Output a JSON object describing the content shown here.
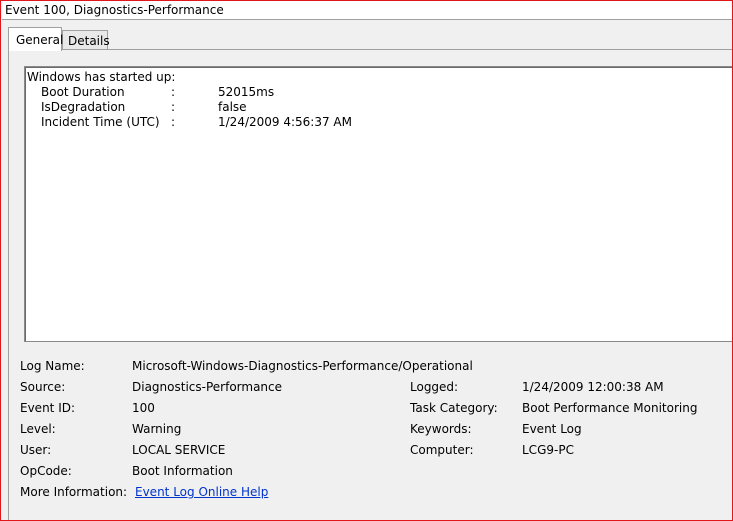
{
  "window": {
    "title": "Event 100, Diagnostics-Performance"
  },
  "tabs": [
    {
      "label": "General",
      "active": true
    },
    {
      "label": "Details",
      "active": false
    }
  ],
  "message": {
    "intro": "Windows has started up:",
    "rows": [
      {
        "name": "Boot Duration",
        "sep": ":",
        "value": "52015ms"
      },
      {
        "name": "IsDegradation",
        "sep": ":",
        "value": "false"
      },
      {
        "name": "Incident Time (UTC)",
        "sep": ":",
        "value": "1/24/2009 4:56:37 AM"
      }
    ]
  },
  "details": {
    "log_name": {
      "label": "Log Name:",
      "value": "Microsoft-Windows-Diagnostics-Performance/Operational"
    },
    "source": {
      "label": "Source:",
      "value": "Diagnostics-Performance"
    },
    "logged": {
      "label": "Logged:",
      "value": "1/24/2009 12:00:38 AM"
    },
    "event_id": {
      "label": "Event ID:",
      "value": "100"
    },
    "task_category": {
      "label": "Task Category:",
      "value": "Boot Performance Monitoring"
    },
    "level": {
      "label": "Level:",
      "value": "Warning"
    },
    "keywords": {
      "label": "Keywords:",
      "value": "Event Log"
    },
    "user": {
      "label": "User:",
      "value": "LOCAL SERVICE"
    },
    "computer": {
      "label": "Computer:",
      "value": "LCG9-PC"
    },
    "opcode": {
      "label": "OpCode:",
      "value": "Boot Information"
    },
    "more_info": {
      "label": "More Information:",
      "link": "Event Log Online Help"
    }
  },
  "colors": {
    "frame_border": "#e0161b",
    "link": "#0033cc"
  }
}
